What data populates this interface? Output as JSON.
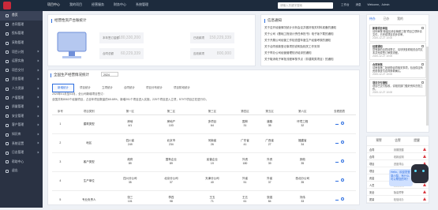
{
  "topbar": {
    "nav": [
      "项目中心",
      "我的项目",
      "经营服务",
      "财务中心",
      "系统管理"
    ],
    "search_placeholder": "请输入关键字搜索",
    "right": [
      "工作台",
      "消息",
      "Welcome，Admin"
    ]
  },
  "sidebar": {
    "items": [
      "首页",
      "合同管理",
      "投标管理",
      "采购管理",
      "项目计划",
      "运营实施",
      "项目交付",
      "资金管理",
      "人力资源",
      "产值管理",
      "质量管理",
      "安全管理",
      "客户管理",
      "知识库",
      "系统设置",
      "日志管理",
      "帮助中心",
      "退出"
    ]
  },
  "overview": {
    "title": "经营性资产台账统计",
    "stats": [
      {
        "label": "本年签订金额",
        "value": "180,330,200"
      },
      {
        "label": "已收款项",
        "value": "150,229,339"
      },
      {
        "label": "合同总额",
        "value": "60,229,339"
      },
      {
        "label": "应收款项",
        "value": "800,000"
      }
    ]
  },
  "news": {
    "title": "信息通知",
    "items": [
      "关于召开经营情况统计分析会议并做好相关材料准备的通知",
      "关于公司《基础工程设计责任承担书》电子版下载的通知",
      "关于开展公司经营工作检查暨年度生产经营考核的通知",
      "关于合同收款登记事项的说明及相关工作安排",
      "关于举办公司经营管理知识培训的通知",
      "关于取消电子审批流程审核节点（非建筑类项目）的通知"
    ]
  },
  "table_section": {
    "title": "全国生产经营情况统计",
    "year": "2024",
    "tabs": [
      "新增统计",
      "项目统计",
      "立项统计",
      "合同统计",
      "项目分布统计",
      "项目阶段统计"
    ],
    "summary1": "2020年01月至03月，全公司新增项目签订：",
    "summary2": "全国共有8063个经营项目，占全年项目数量的65.68%，新增291个项目进入实施，225个项目进入立项，579个项目正在进行中。",
    "headers": [
      "序号",
      "项目类别",
      "第一区",
      "第二区",
      "第三区",
      "第四区",
      "第五区",
      "第六区",
      "查看图表"
    ],
    "rows": [
      {
        "label": "建筑类型",
        "cells": [
          [
            "房地",
            "4/1"
          ],
          [
            "房地产",
            "103"
          ],
          [
            "多项目",
            "64"
          ],
          [
            "国林",
            "31"
          ],
          [
            "道路",
            "35"
          ],
          [
            "环境工程",
            "32"
          ]
        ]
      },
      {
        "label": "地区",
        "cells": [
          [
            "四川省",
            "249"
          ],
          [
            "北京市",
            "234"
          ],
          [
            "河南省",
            "26"
          ],
          [
            "广东省",
            "41"
          ],
          [
            "广西省",
            "27"
          ],
          [
            "福建省",
            "34"
          ]
        ]
      },
      {
        "label": "客户类型",
        "cells": [
          [
            "政府",
            "89"
          ],
          [
            "国有企业",
            "89"
          ],
          [
            "民营企业",
            "19"
          ],
          [
            "外资",
            "180"
          ],
          [
            "外资",
            "39"
          ],
          [
            "其他",
            "35"
          ]
        ]
      },
      {
        "label": "生产单位",
        "cells": [
          [
            "四川分公司",
            "35"
          ],
          [
            "北京分公司",
            "37"
          ],
          [
            "天津分公司",
            "40"
          ],
          [
            "外省",
            "51"
          ],
          [
            "外省",
            "37"
          ],
          [
            "西北分公司",
            "35"
          ]
        ]
      },
      {
        "label": "专业负责人",
        "cells": [
          [
            "张三",
            "101"
          ],
          [
            "李四",
            "98"
          ],
          [
            "王五",
            "71"
          ],
          [
            "王五",
            "61"
          ],
          [
            "张强",
            "84"
          ],
          [
            "刘伟",
            "33"
          ]
        ]
      }
    ]
  },
  "right_panel": {
    "tabs": [
      "待办",
      "已办",
      "我的"
    ],
    "cards": [
      {
        "title": "新增项目审批",
        "body": "请你审核“新建区综合管廊工程”项目立项申请文件，已完成项目初步评审。",
        "date": "2020-12-27 10:00"
      },
      {
        "title": "经营通知",
        "body": "您有新的合同待签订，请尽快查看相关合同文本并完成签订审核流程。",
        "date": "2020-12-27 10:00"
      },
      {
        "title": "合同审核",
        "body": "请审核第二批采购合同相关事项，包含供应商资质核查与合同条款确认。",
        "date": "2020-12-27 10:00"
      },
      {
        "title": "项目交付通知",
        "body": "项目已交付验收，请相关部门做好资料归档工作。",
        "date": "2020-12-27 10:00"
      }
    ]
  },
  "alerts": {
    "tabs": [
      "预警",
      "告警",
      "提醒"
    ],
    "rows": [
      {
        "a": "合同",
        "b": "到期提醒"
      },
      {
        "a": "合同",
        "b": "收款逾期"
      },
      {
        "a": "项目",
        "b": "进度滞后"
      },
      {
        "a": "项目",
        "b": "成本超支"
      },
      {
        "a": "资金",
        "b": "余额不足"
      },
      {
        "a": "人员",
        "b": "资质到期"
      },
      {
        "a": "安全",
        "b": "隐患预警"
      },
      {
        "a": "质量",
        "b": "检验待办"
      }
    ]
  },
  "assistant": {
    "greeting": "Hello，欢迎您登录小智，有什么可以帮您的吗？"
  },
  "colors": {
    "accent": "#2d6ee0",
    "alert": "#d9363e",
    "sidebar": "#2a3243",
    "topbar": "#1d2b3d"
  }
}
